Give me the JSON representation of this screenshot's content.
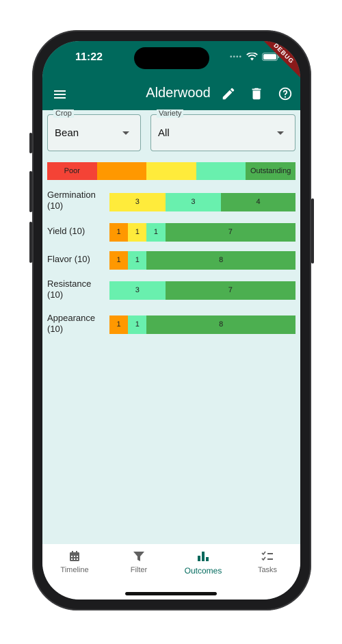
{
  "status_bar": {
    "time": "11:22",
    "debug_label": "DEBUG"
  },
  "app_bar": {
    "title": "Alderwood",
    "icons": [
      "menu-icon",
      "edit-icon",
      "delete-icon",
      "help-icon"
    ]
  },
  "filters": {
    "crop": {
      "label": "Crop",
      "value": "Bean"
    },
    "variety": {
      "label": "Variety",
      "value": "All"
    }
  },
  "legend": {
    "labels": [
      "Poor",
      "",
      "",
      "",
      "Outstanding"
    ],
    "colors": [
      "#f44336",
      "#ff9800",
      "#ffeb3b",
      "#69f0ae",
      "#4caf50"
    ]
  },
  "outcomes": [
    {
      "label": "Germination",
      "count": "(10)",
      "segments": [
        {
          "value": "3",
          "color": "#ffeb3b",
          "fraction": 0.3
        },
        {
          "value": "3",
          "color": "#69f0ae",
          "fraction": 0.3
        },
        {
          "value": "4",
          "color": "#4caf50",
          "fraction": 0.4
        }
      ]
    },
    {
      "label": "Yield",
      "count": "(10)",
      "segments": [
        {
          "value": "1",
          "color": "#ff9800",
          "fraction": 0.1
        },
        {
          "value": "1",
          "color": "#ffeb3b",
          "fraction": 0.1
        },
        {
          "value": "1",
          "color": "#69f0ae",
          "fraction": 0.1
        },
        {
          "value": "7",
          "color": "#4caf50",
          "fraction": 0.7
        }
      ]
    },
    {
      "label": "Flavor",
      "count": "(10)",
      "segments": [
        {
          "value": "1",
          "color": "#ff9800",
          "fraction": 0.1
        },
        {
          "value": "1",
          "color": "#69f0ae",
          "fraction": 0.1
        },
        {
          "value": "8",
          "color": "#4caf50",
          "fraction": 0.8
        }
      ]
    },
    {
      "label": "Resistance",
      "count": "(10)",
      "segments": [
        {
          "value": "3",
          "color": "#69f0ae",
          "fraction": 0.3
        },
        {
          "value": "7",
          "color": "#4caf50",
          "fraction": 0.7
        }
      ]
    },
    {
      "label": "Appearance",
      "count": "(10)",
      "segments": [
        {
          "value": "1",
          "color": "#ff9800",
          "fraction": 0.1
        },
        {
          "value": "1",
          "color": "#69f0ae",
          "fraction": 0.1
        },
        {
          "value": "8",
          "color": "#4caf50",
          "fraction": 0.8
        }
      ]
    }
  ],
  "nav": {
    "items": [
      {
        "label": "Timeline",
        "icon": "calendar-icon"
      },
      {
        "label": "Filter",
        "icon": "filter-icon"
      },
      {
        "label": "Outcomes",
        "icon": "bar-chart-icon",
        "active": true
      },
      {
        "label": "Tasks",
        "icon": "checklist-icon"
      }
    ]
  },
  "colors": {
    "primary": "#00695c",
    "background": "#e0f2f1"
  }
}
